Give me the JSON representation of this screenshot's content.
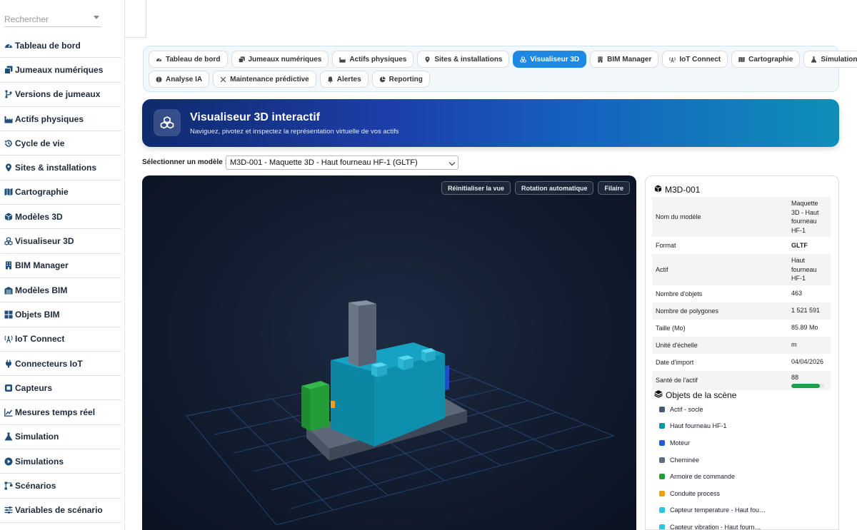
{
  "search": {
    "placeholder": "Rechercher"
  },
  "sidebar": {
    "items": [
      {
        "label": "Tableau de bord",
        "icon": "gauge-icon"
      },
      {
        "label": "Jumeaux numériques",
        "icon": "copy-icon"
      },
      {
        "label": "Versions de jumeaux",
        "icon": "branch-icon"
      },
      {
        "label": "Actifs physiques",
        "icon": "industry-icon"
      },
      {
        "label": "Cycle de vie",
        "icon": "history-icon"
      },
      {
        "label": "Sites & installations",
        "icon": "map-pin-icon"
      },
      {
        "label": "Cartographie",
        "icon": "map-icon"
      },
      {
        "label": "Modèles 3D",
        "icon": "cube-icon"
      },
      {
        "label": "Visualiseur 3D",
        "icon": "cubes-icon"
      },
      {
        "label": "BIM Manager",
        "icon": "building-icon"
      },
      {
        "label": "Modèles BIM",
        "icon": "warehouse-icon"
      },
      {
        "label": "Objets BIM",
        "icon": "grid-icon"
      },
      {
        "label": "IoT Connect",
        "icon": "antenna-icon"
      },
      {
        "label": "Connecteurs IoT",
        "icon": "plug-icon"
      },
      {
        "label": "Capteurs",
        "icon": "sensor-icon"
      },
      {
        "label": "Mesures temps réel",
        "icon": "line-chart-icon"
      },
      {
        "label": "Simulation",
        "icon": "flask-icon"
      },
      {
        "label": "Simulations",
        "icon": "play-circle-icon"
      },
      {
        "label": "Scénarios",
        "icon": "project-diagram-icon"
      },
      {
        "label": "Variables de scénario",
        "icon": "sliders-icon"
      }
    ]
  },
  "tabs": {
    "row1": [
      {
        "label": "Tableau de bord",
        "icon": "gauge-icon"
      },
      {
        "label": "Jumeaux numériques",
        "icon": "copy-icon"
      },
      {
        "label": "Actifs physiques",
        "icon": "industry-icon"
      },
      {
        "label": "Sites & installations",
        "icon": "map-pin-icon"
      },
      {
        "label": "Visualiseur 3D",
        "icon": "cubes-icon",
        "active": true
      },
      {
        "label": "BIM Manager",
        "icon": "building-icon"
      },
      {
        "label": "IoT Connect",
        "icon": "antenna-icon"
      },
      {
        "label": "Cartographie",
        "icon": "map-icon"
      },
      {
        "label": "Simulation",
        "icon": "flask-icon"
      }
    ],
    "row2": [
      {
        "label": "Analyse IA",
        "icon": "brain-icon"
      },
      {
        "label": "Maintenance prédictive",
        "icon": "tools-icon"
      },
      {
        "label": "Alertes",
        "icon": "bell-icon"
      },
      {
        "label": "Reporting",
        "icon": "pie-icon"
      }
    ]
  },
  "banner": {
    "title": "Visualiseur 3D interactif",
    "subtitle": "Naviguez, pivotez et inspectez la représentation virtuelle de vos actifs"
  },
  "model_select": {
    "label": "Sélectionner un modèle :",
    "value": "M3D-001 - Maquette 3D - Haut fourneau HF-1 (GLTF)"
  },
  "viewer": {
    "reset_label": "Réinitialiser la vue",
    "rotate_label": "Rotation automatique",
    "wire_label": "Filaire"
  },
  "info": {
    "title": "M3D-001",
    "rows": [
      {
        "label": "Nom du modèle",
        "value": "Maquette 3D - Haut fourneau HF-1"
      },
      {
        "label": "Format",
        "value": "GLTF"
      },
      {
        "label": "Actif",
        "value": "Haut fourneau HF-1"
      },
      {
        "label": "Nombre d'objets",
        "value": "463"
      },
      {
        "label": "Nombre de polygones",
        "value": "1 521 591"
      },
      {
        "label": "Taille (Mo)",
        "value": "85.89 Mo"
      },
      {
        "label": "Unité d'échelle",
        "value": "m"
      },
      {
        "label": "Date d'import",
        "value": "04/04/2026"
      },
      {
        "label": "Santé de l'actif",
        "value": "88"
      }
    ],
    "health_percent": 88
  },
  "scene_objects": {
    "title": "Objets de la scène",
    "items": [
      {
        "label": "Actif - socle",
        "color": "#4a5a75"
      },
      {
        "label": "Haut fourneau HF-1",
        "color": "#0097a7"
      },
      {
        "label": "Moteur",
        "color": "#1e5ed6"
      },
      {
        "label": "Cheminée",
        "color": "#5f6b7c"
      },
      {
        "label": "Armoire de commande",
        "color": "#22a03c"
      },
      {
        "label": "Conduite process",
        "color": "#f39c12"
      },
      {
        "label": "Capteur temperature - Haut fou…",
        "color": "#2ec4e6"
      },
      {
        "label": "Capteur vibration - Haut fourn…",
        "color": "#2ec4e6"
      }
    ]
  }
}
